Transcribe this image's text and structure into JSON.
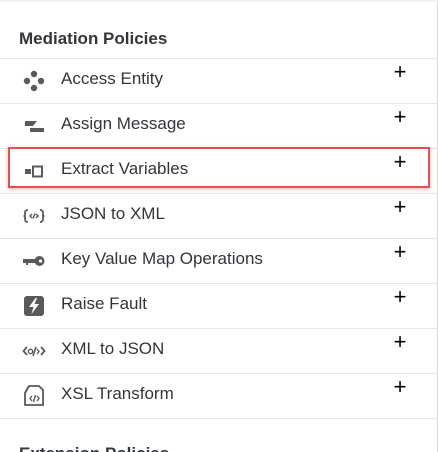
{
  "section": {
    "title": "Mediation Policies",
    "next_title": "Extension Policies"
  },
  "policies": [
    {
      "label": "Access Entity",
      "icon": "access-entity-icon",
      "add": "+"
    },
    {
      "label": "Assign Message",
      "icon": "assign-message-icon",
      "add": "+"
    },
    {
      "label": "Extract Variables",
      "icon": "extract-variables-icon",
      "add": "+",
      "highlighted": true
    },
    {
      "label": "JSON to XML",
      "icon": "json-to-xml-icon",
      "add": "+"
    },
    {
      "label": "Key Value Map Operations",
      "icon": "key-icon",
      "add": "+"
    },
    {
      "label": "Raise Fault",
      "icon": "raise-fault-icon",
      "add": "+"
    },
    {
      "label": "XML to JSON",
      "icon": "xml-to-json-icon",
      "add": "+"
    },
    {
      "label": "XSL Transform",
      "icon": "xsl-transform-icon",
      "add": "+"
    }
  ],
  "colors": {
    "text": "#32363a",
    "icon": "#5a5a5a",
    "divider": "#e5e5e5",
    "highlight": "#e05252"
  }
}
